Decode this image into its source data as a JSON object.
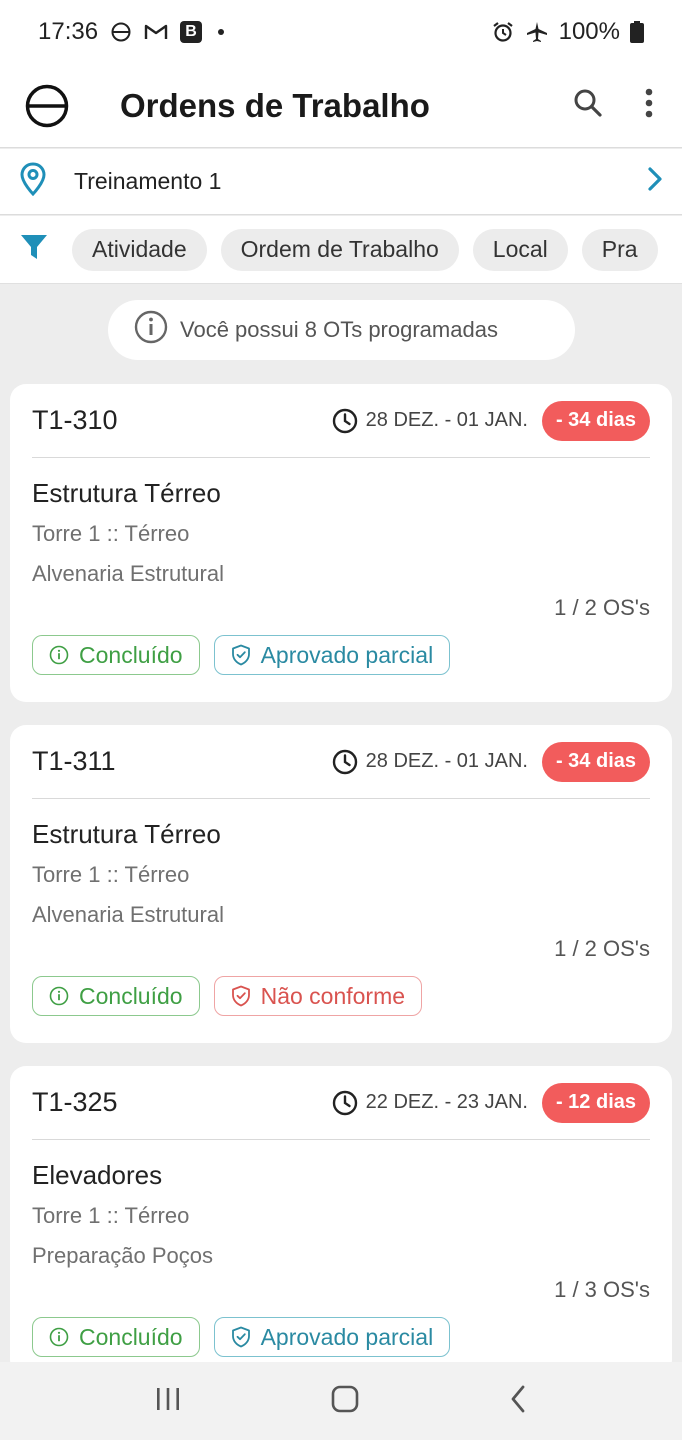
{
  "status_bar": {
    "time": "17:36",
    "b_badge": "B",
    "battery": "100%"
  },
  "app_bar": {
    "title": "Ordens de Trabalho",
    "icons": [
      "logo-icon",
      "search-icon",
      "more-vert-icon"
    ]
  },
  "location": {
    "label": "Treinamento 1",
    "icons": [
      "location-pin-icon",
      "chevron-right-icon"
    ]
  },
  "filters": {
    "chips": [
      "Atividade",
      "Ordem de Trabalho",
      "Local",
      "Pra"
    ]
  },
  "banner": {
    "text": "Você possui 8 OTs programadas"
  },
  "cards": [
    {
      "code": "T1-310",
      "date_range": "28 DEZ. - 01 JAN.",
      "days": "- 34 dias",
      "name": "Estrutura Térreo",
      "location": "Torre 1 :: Térreo",
      "activity": "Alvenaria Estrutural",
      "count": "1 / 2 OS's",
      "status": "Concluído",
      "approval": "Aprovado parcial"
    },
    {
      "code": "T1-311",
      "date_range": "28 DEZ. - 01 JAN.",
      "days": "- 34 dias",
      "name": "Estrutura Térreo",
      "location": "Torre 1 :: Térreo",
      "activity": "Alvenaria Estrutural",
      "count": "1 / 2 OS's",
      "status": "Concluído",
      "approval": "Não conforme"
    },
    {
      "code": "T1-325",
      "date_range": "22 DEZ. - 23 JAN.",
      "days": "- 12 dias",
      "name": "Elevadores",
      "location": "Torre 1 :: Térreo",
      "activity": "Preparação Poços",
      "count": "1 / 3 OS's",
      "status": "Concluído",
      "approval": "Aprovado parcial"
    }
  ],
  "colors": {
    "accent": "#1f8fb8",
    "overdue": "#f25c5c",
    "green": "#3f9f44",
    "blue": "#2a8aa2",
    "red": "#d9534f"
  }
}
